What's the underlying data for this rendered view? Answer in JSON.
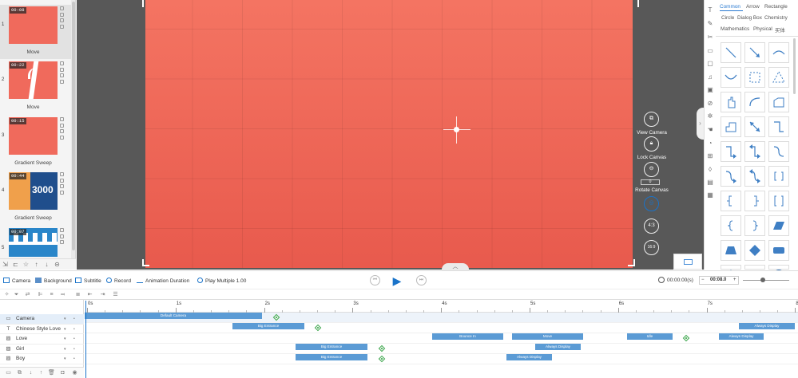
{
  "slides": [
    {
      "number": "1",
      "time": "00:08",
      "name": "Move"
    },
    {
      "number": "2",
      "time": "00:22",
      "name": "Move"
    },
    {
      "number": "3",
      "time": "00:15",
      "name": "Gradient Sweep"
    },
    {
      "number": "4",
      "time": "00:44",
      "name": "Gradient Sweep",
      "thumb_text": "3000"
    },
    {
      "number": "5",
      "time": "00:07",
      "name": ""
    }
  ],
  "camera_controls": {
    "view_camera": "View Camera",
    "lock_canvas": "Lock Canvas",
    "rotate_canvas": "Rotate Canvas",
    "rotate_value": "0",
    "aspect_ratio": "4:3",
    "ratio_alt": "16:9"
  },
  "shapes_panel": {
    "tabs": [
      "Common",
      "Arrow",
      "Rectangle",
      "Circle",
      "Dialog Box",
      "Chemistry",
      "Mathematics",
      "Physical",
      "买体"
    ],
    "active_tab": "Common"
  },
  "timeline_toolbar": {
    "camera": "Camera",
    "background": "Background",
    "subtitle": "Subtitle",
    "record": "Record",
    "animation_duration": "Animation Duration",
    "play_multiple": "Play Multiple 1.00",
    "time": "00:00:00(s)",
    "duration": "00:08.0"
  },
  "ruler": {
    "labels": [
      "0s",
      "1s",
      "2s",
      "3s",
      "4s",
      "5s",
      "6s",
      "7s",
      "8"
    ]
  },
  "tracks": [
    {
      "name": "Camera",
      "icon": "camera-icon"
    },
    {
      "name": "Chinese Style Love",
      "icon": "text-icon"
    },
    {
      "name": "Love",
      "icon": "image-icon"
    },
    {
      "name": "Girl",
      "icon": "image-icon"
    },
    {
      "name": "Boy",
      "icon": "image-icon"
    }
  ],
  "track_blocks": {
    "camera": [
      "Default Camera"
    ],
    "chinese_style_love": [
      "Big Entrance",
      "Always Display"
    ],
    "love": [
      "Bounce In",
      "Move",
      "Idle",
      "Always Display"
    ],
    "girl": [
      "Big Entrance",
      "Always Display"
    ],
    "boy": [
      "Big Entrance",
      "Always Display"
    ]
  },
  "colors": {
    "canvas": "#f06a5c",
    "accent": "#1a73c9",
    "block": "#5b9bd5",
    "keyframe": "#3aa54a",
    "stage_bg": "#585858"
  }
}
